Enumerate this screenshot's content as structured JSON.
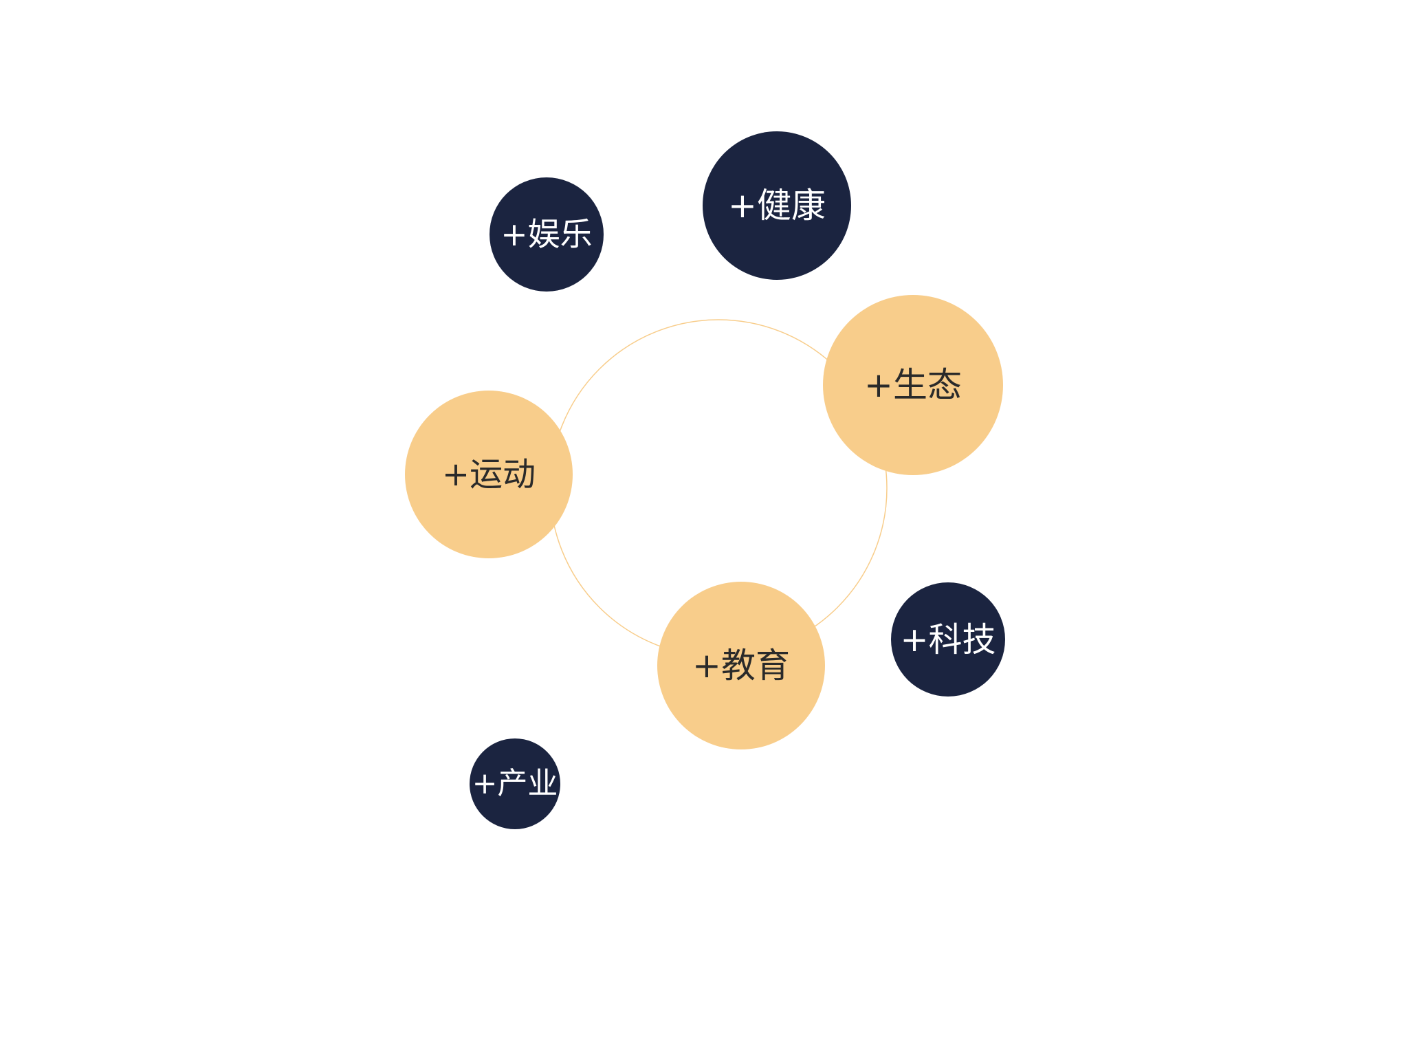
{
  "colors": {
    "dark_fill": "#1b2440",
    "light_fill": "#f8cd8b",
    "ring_stroke": "#f8cd8b"
  },
  "bubbles": {
    "health": "+健康",
    "entertainment": "+娱乐",
    "ecology": "+生态",
    "sports": "+运动",
    "education": "+教育",
    "technology": "+科技",
    "industry": "+产业"
  }
}
